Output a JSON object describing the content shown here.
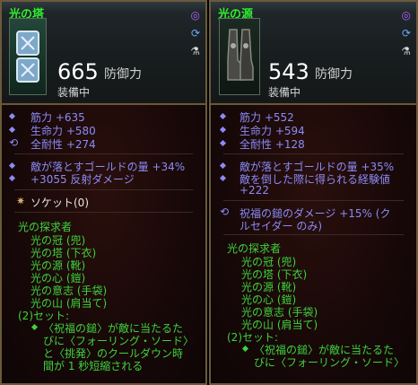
{
  "panels": [
    {
      "title": "光の塔",
      "armor_value": "665",
      "armor_label": "防御力",
      "equipped": "装備中",
      "stats": [
        "筋力 +635",
        "生命力 +580",
        "全耐性 +274"
      ],
      "stats2": [
        "敵が落とすゴールドの量 +34%",
        "+3055 反射ダメージ"
      ],
      "socket": "ソケット(0)",
      "set_name": "光の探求者",
      "set_items": [
        "光の冠 (兜)",
        "光の塔 (下衣)",
        "光の源 (靴)",
        "光の心 (鎧)",
        "光の意志 (手袋)",
        "光の山 (肩当て)"
      ],
      "set_bonus_label": "(2)セット:",
      "set_bonus_lines": [
        "〈祝福の鎚〉が敵に当たるた",
        "びに〈フォーリング・ソード〉",
        "と〈挑発〉のクールダウン時",
        "間が 1 秒短縮される"
      ]
    },
    {
      "title": "光の源",
      "armor_value": "543",
      "armor_label": "防御力",
      "equipped": "装備中",
      "stats": [
        "筋力 +552",
        "生命力 +594",
        "全耐性 +128"
      ],
      "stats2": [
        "敵が落とすゴールドの量 +35%",
        "敵を倒した際に得られる経験値",
        "+222"
      ],
      "special": [
        "祝福の鎚のダメージ +15% (ク",
        "ルセイダー のみ)"
      ],
      "set_name": "光の探求者",
      "set_items": [
        "光の冠 (兜)",
        "光の塔 (下衣)",
        "光の源 (靴)",
        "光の心 (鎧)",
        "光の意志 (手袋)",
        "光の山 (肩当て)"
      ],
      "set_bonus_label": "(2)セット:",
      "set_bonus_lines": [
        "〈祝福の鎚〉が敵に当たるた",
        "びに〈フォーリング・ソード〉"
      ]
    }
  ]
}
